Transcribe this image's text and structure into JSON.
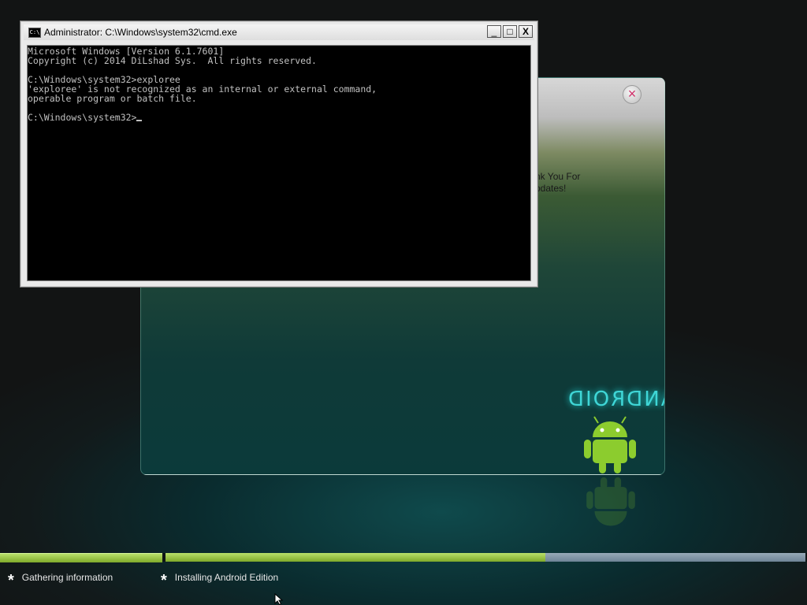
{
  "installer": {
    "close_glyph": "×",
    "thanks_line1": "nk You For",
    "thanks_line2": "pdates!",
    "logo_text": "ANDROID",
    "accent_color": "#3fd6d6"
  },
  "cmd": {
    "icon_text": "C:\\",
    "title": "Administrator: C:\\Windows\\system32\\cmd.exe",
    "minimize_glyph": "_",
    "maximize_glyph": "□",
    "close_glyph": "X",
    "lines": [
      "Microsoft Windows [Version 6.1.7601]",
      "Copyright (c) 2014 DiLshad Sys.  All rights reserved.",
      "",
      "C:\\Windows\\system32>exploree",
      "'exploree' is not recognized as an internal or external command,",
      "operable program or batch file.",
      "",
      "C:\\Windows\\system32>"
    ]
  },
  "progress": {
    "stage1_fill": 1.0,
    "stage2_fill": 0.593,
    "fill_color": "#8fc23a",
    "empty_color": "#7f93a5"
  },
  "status": {
    "stage1_label": "Gathering information",
    "stage2_label": "Installing Android Edition",
    "bullet": "*"
  }
}
